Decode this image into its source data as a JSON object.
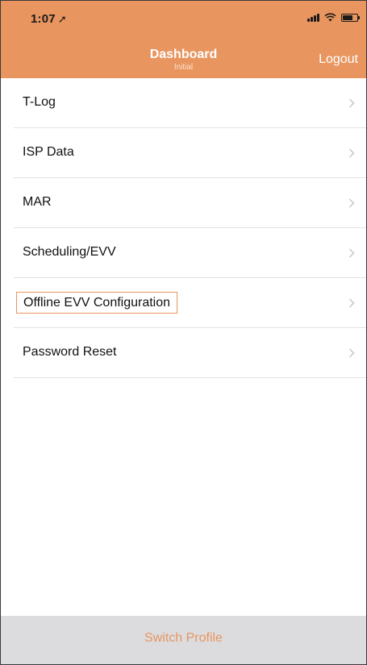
{
  "status_bar": {
    "time": "1:07",
    "location_icon": "location-arrow-icon",
    "icons": [
      "signal-icon",
      "wifi-icon",
      "battery-icon"
    ]
  },
  "nav": {
    "title": "Dashboard",
    "subtitle": "Initial",
    "logout_label": "Logout"
  },
  "menu": {
    "items": [
      {
        "label": "T-Log"
      },
      {
        "label": "ISP Data"
      },
      {
        "label": "MAR"
      },
      {
        "label": "Scheduling/EVV"
      },
      {
        "label": "Offline EVV Configuration",
        "highlighted": true
      },
      {
        "label": "Password Reset"
      }
    ]
  },
  "footer": {
    "switch_profile_label": "Switch Profile"
  },
  "colors": {
    "accent": "#e8955f",
    "tab_bar": "#dcdcdf",
    "divider": "#e2e2e2",
    "chevron": "#c7c7cc"
  }
}
